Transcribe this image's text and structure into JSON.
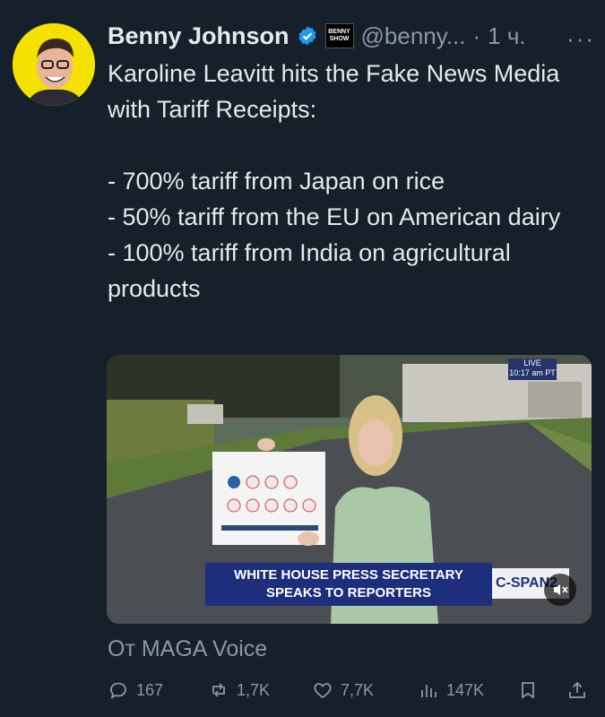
{
  "post": {
    "author_name": "Benny Johnson",
    "author_handle": "@benny...",
    "separator": "·",
    "time": "1 ч.",
    "more_label": "···",
    "badge_text": "BENNY SHOW",
    "text": "Karoline Leavitt hits the Fake News Media with Tariff Receipts:\n\n- 700% tariff from Japan on rice\n- 50% tariff from the EU on American dairy\n- 100% tariff from India on agricultural products"
  },
  "media": {
    "chyron_line1": "WHITE HOUSE PRESS SECRETARY",
    "chyron_line2": "SPEAKS TO REPORTERS",
    "network": "C-SPAN",
    "network_number": "2",
    "live_label": "LIVE",
    "live_time": "10:17 am PT",
    "mute_icon": "speaker-muted-icon"
  },
  "attribution": "От MAGA Voice",
  "actions": {
    "replies": "167",
    "reposts": "1,7K",
    "likes": "7,7K",
    "views": "147K"
  },
  "colors": {
    "background": "#15202b",
    "text": "#e7e9ea",
    "muted": "#8b98a5",
    "verified": "#1d9bf0",
    "avatar_bg": "#f5e100"
  }
}
